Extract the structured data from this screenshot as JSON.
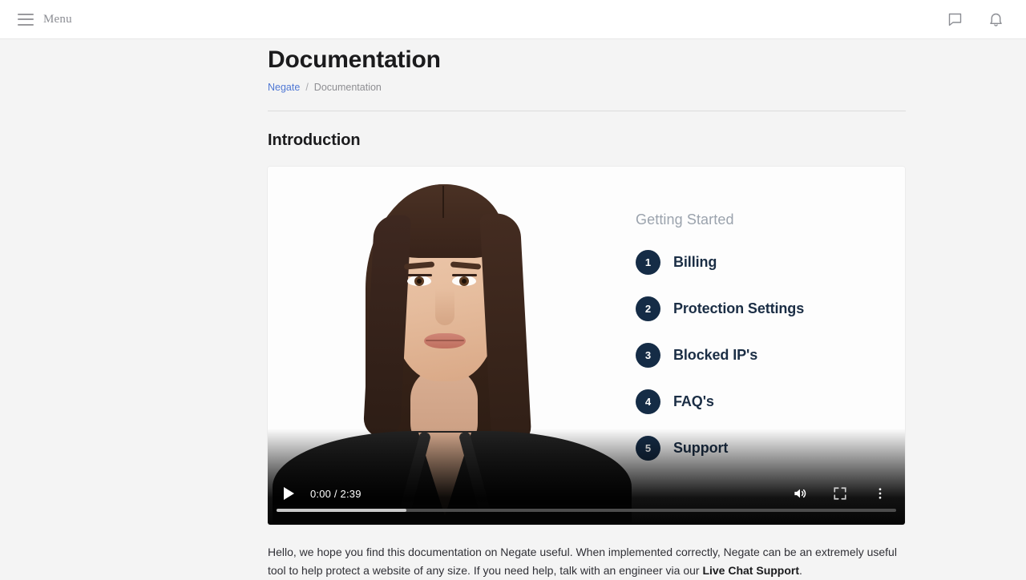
{
  "topbar": {
    "menu_label": "Menu",
    "hamburger_icon": "hamburger-menu-icon",
    "chat_icon": "chat-bubble-icon",
    "bell_icon": "notification-bell-icon"
  },
  "header": {
    "title": "Documentation",
    "breadcrumb": {
      "root": "Negate",
      "separator": "/",
      "current": "Documentation"
    }
  },
  "main": {
    "section_title": "Introduction",
    "video": {
      "getting_started_title": "Getting Started",
      "items": [
        {
          "num": "1",
          "label": "Billing"
        },
        {
          "num": "2",
          "label": "Protection Settings"
        },
        {
          "num": "3",
          "label": "Blocked IP's"
        },
        {
          "num": "4",
          "label": "FAQ's"
        },
        {
          "num": "5",
          "label": "Support"
        }
      ],
      "controls": {
        "play_icon": "play-icon",
        "time": "0:00 / 2:39",
        "current_time": "0:00",
        "duration": "2:39",
        "volume_icon": "volume-icon",
        "fullscreen_icon": "fullscreen-icon",
        "more_icon": "more-vertical-icon",
        "buffered_percent": "21%"
      }
    },
    "paragraph": {
      "part1": "Hello, we hope you find this documentation on Negate useful. When implemented correctly, Negate can be an extremely useful tool to help protect a website of any size. If you need help, talk with an engineer via our ",
      "link": "Live Chat Support",
      "part2": "."
    }
  },
  "colors": {
    "page_bg": "#f4f4f4",
    "topbar_bg": "#ffffff",
    "accent_navy": "#152c46",
    "link_blue": "#5078d4",
    "muted_gray": "#8e8e92"
  }
}
